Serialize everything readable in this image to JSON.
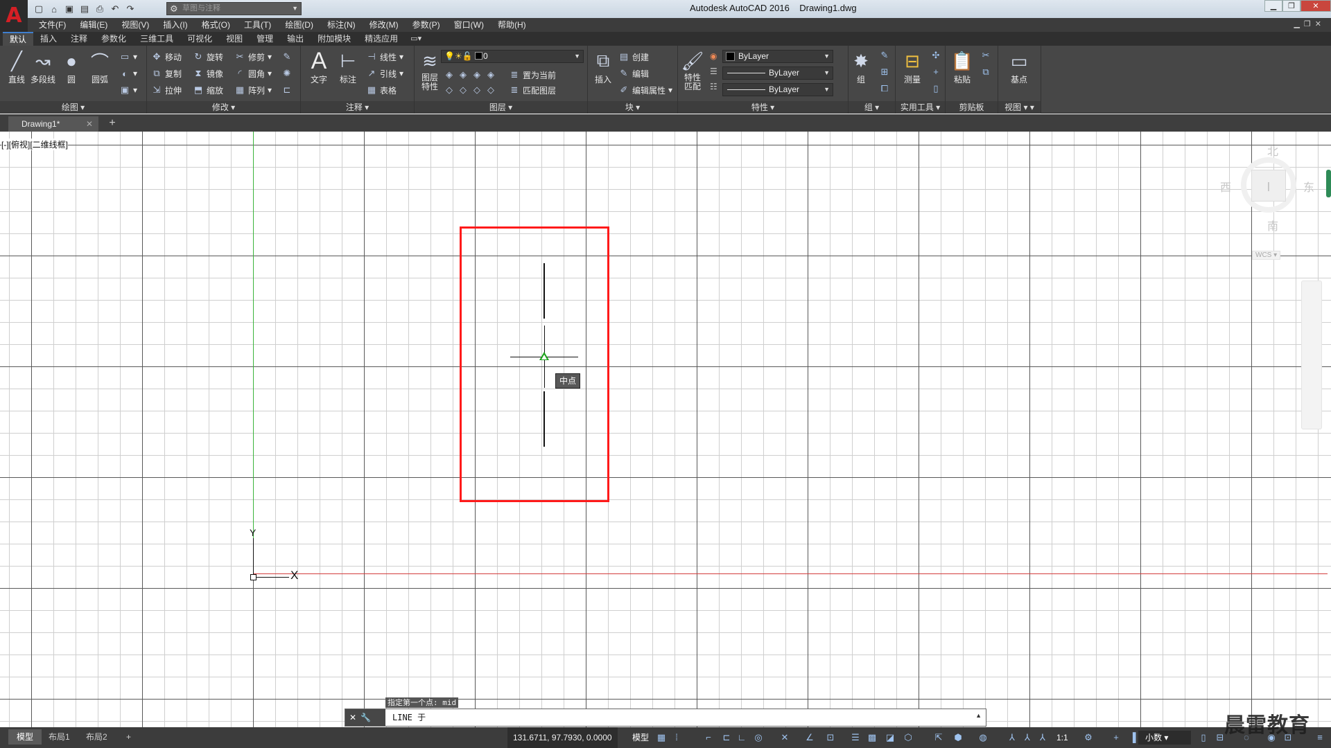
{
  "window": {
    "title": "Autodesk AutoCAD 2016    Drawing1.dwg",
    "workspace": "草图与注释"
  },
  "menu": [
    "文件(F)",
    "编辑(E)",
    "视图(V)",
    "插入(I)",
    "格式(O)",
    "工具(T)",
    "绘图(D)",
    "标注(N)",
    "修改(M)",
    "参数(P)",
    "窗口(W)",
    "帮助(H)"
  ],
  "ribbon_tabs": [
    "默认",
    "插入",
    "注释",
    "参数化",
    "三维工具",
    "可视化",
    "视图",
    "管理",
    "输出",
    "附加模块",
    "精选应用"
  ],
  "panels": {
    "draw": {
      "title": "绘图",
      "line": "直线",
      "polyline": "多段线",
      "circle": "圆",
      "arc": "圆弧"
    },
    "modify": {
      "title": "修改",
      "move": "移动",
      "rotate": "旋转",
      "trim": "修剪",
      "copy": "复制",
      "mirror": "镜像",
      "fillet": "圆角",
      "stretch": "拉伸",
      "scale": "缩放",
      "array": "阵列"
    },
    "annotation": {
      "title": "注释",
      "text": "文字",
      "dimension": "标注",
      "linear": "线性",
      "leader": "引线",
      "table": "表格"
    },
    "layers": {
      "title": "图层",
      "layer_props": "图层\n特性",
      "current_layer": "0",
      "set_current": "置为当前",
      "match_layer": "匹配图层"
    },
    "block": {
      "title": "块",
      "insert": "插入",
      "create": "创建",
      "edit": "编辑",
      "edit_attr": "编辑属性"
    },
    "properties": {
      "title": "特性",
      "match": "特性\n匹配",
      "color": "ByLayer",
      "linetype": "ByLayer",
      "lineweight": "ByLayer"
    },
    "groups": {
      "title": "组",
      "group": "组"
    },
    "utilities": {
      "title": "实用工具",
      "measure": "测量"
    },
    "clipboard": {
      "title": "剪贴板",
      "paste": "粘贴"
    },
    "view": {
      "title": "视图",
      "base": "基点"
    }
  },
  "file_tab": "Drawing1*",
  "viewport_label": "[-][俯视][二维线框]",
  "viewcube": {
    "north": "北",
    "south": "南",
    "west": "西",
    "east": "东",
    "wcs": "WCS"
  },
  "ucs": {
    "x": "X",
    "y": "Y"
  },
  "snap_tooltip": "中点",
  "command": {
    "history": "指定第一个点: mid",
    "input": "LINE 于"
  },
  "layout_tabs": [
    "模型",
    "布局1",
    "布局2"
  ],
  "status": {
    "coords": "131.6711, 97.7930, 0.0000",
    "model": "模型",
    "scale": "1:1",
    "units": "小数"
  },
  "watermark": "晨雷教育",
  "colors": {
    "highlight": "#ff1a1a",
    "snap": "#1aa31a",
    "x_axis": "#d23b3b",
    "y_axis": "#3ab43a"
  }
}
